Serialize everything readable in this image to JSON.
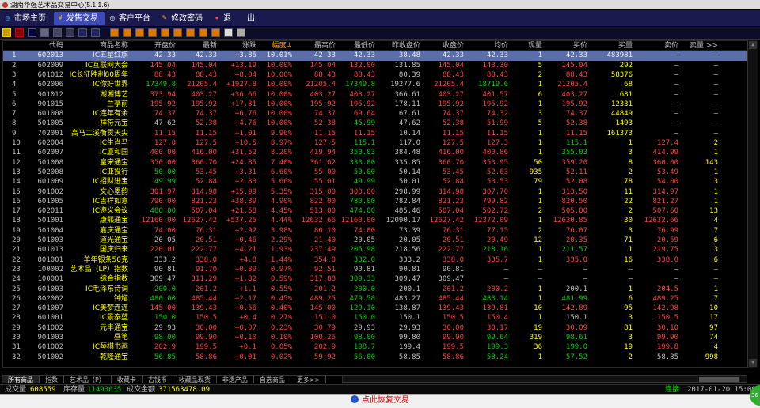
{
  "window": {
    "title": "湖南华强艺术品交易中心(5.1.1.6)"
  },
  "menu": [
    {
      "label": "市场主页",
      "icon": "globe-icon",
      "active": false
    },
    {
      "label": "发售交易",
      "icon": "money-icon",
      "active": true
    },
    {
      "label": "客户平台",
      "icon": "client-icon",
      "active": false
    },
    {
      "label": "修改密码",
      "icon": "key-icon",
      "active": false
    },
    {
      "label": "退　　出",
      "icon": "exit-icon",
      "active": false
    }
  ],
  "columns": [
    "",
    "代码",
    "商品名称",
    "开盘价",
    "最新",
    "涨跌",
    "幅度↓",
    "最高价",
    "最低价",
    "昨收盘价",
    "收盘价",
    "均价",
    "现量",
    "买价",
    "买量",
    "卖价",
    "卖量 >>"
  ],
  "rows": [
    [
      "1",
      "602013",
      "IC五星红旗",
      "42.33",
      "42.33",
      "+3.85",
      "10.01%",
      "42.33",
      "42.33",
      "38.48",
      "42.33",
      "42.33",
      "1",
      "42.33",
      "483981",
      "—",
      "—"
    ],
    [
      "2",
      "602009",
      "IC互联网大会",
      "145.04",
      "145.04",
      "+13.19",
      "10.00%",
      "145.04",
      "132.00",
      "131.85",
      "145.04",
      "143.30",
      "5",
      "145.04",
      "292",
      "—",
      "—"
    ],
    [
      "3",
      "601012",
      "IC长征胜利80周年",
      "88.43",
      "88.43",
      "+8.04",
      "10.00%",
      "88.43",
      "88.43",
      "80.39",
      "88.43",
      "88.43",
      "2",
      "88.43",
      "58376",
      "—",
      "—"
    ],
    [
      "4",
      "602006",
      "IC你好世界",
      "17349.8",
      "21205.4",
      "+1927.8",
      "10.00%",
      "21205.4",
      "17349.8",
      "19277.6",
      "21205.4",
      "18719.6",
      "1",
      "21205.4",
      "68",
      "—",
      "—"
    ],
    [
      "5",
      "901012",
      "湖湘博艺",
      "373.94",
      "403.27",
      "+36.66",
      "10.00%",
      "403.27",
      "403.27",
      "366.61",
      "403.27",
      "401.57",
      "6",
      "403.27",
      "681",
      "—",
      "—"
    ],
    [
      "6",
      "901015",
      "兰亭前",
      "195.92",
      "195.92",
      "+17.81",
      "10.00%",
      "195.92",
      "195.92",
      "178.11",
      "195.92",
      "195.92",
      "1",
      "195.92",
      "12331",
      "—",
      "—"
    ],
    [
      "7",
      "601008",
      "IC连年有余",
      "74.37",
      "74.37",
      "+6.76",
      "10.00%",
      "74.37",
      "69.64",
      "67.61",
      "74.37",
      "74.32",
      "3",
      "74.37",
      "44849",
      "—",
      "—"
    ],
    [
      "8",
      "501005",
      "祥符元宝",
      "47.62",
      "52.38",
      "+4.76",
      "10.00%",
      "52.38",
      "45.99",
      "47.62",
      "52.38",
      "51.99",
      "5",
      "52.38",
      "1493",
      "—",
      "—"
    ],
    [
      "9",
      "702001",
      "高马二溪衡贡天尖",
      "11.15",
      "11.15",
      "+1.01",
      "9.96%",
      "11.15",
      "11.15",
      "10.14",
      "11.15",
      "11.15",
      "1",
      "11.15",
      "161373",
      "—",
      "—"
    ],
    [
      "10",
      "602004",
      "IC生肖马",
      "127.0",
      "127.5",
      "+10.5",
      "8.97%",
      "127.5",
      "115.1",
      "117.0",
      "127.5",
      "127.3",
      "1",
      "115.1",
      "1",
      "127.4",
      "2"
    ],
    [
      "11",
      "602007",
      "IC厦和园",
      "400.00",
      "416.00",
      "+31.52",
      "8.20%",
      "419.94",
      "350.03",
      "384.48",
      "416.00",
      "400.86",
      "1",
      "355.03",
      "3",
      "414.99",
      "1"
    ],
    [
      "12",
      "501008",
      "皇宋通宝",
      "350.00",
      "360.70",
      "+24.85",
      "7.40%",
      "361.02",
      "333.00",
      "335.85",
      "360.70",
      "353.95",
      "50",
      "359.20",
      "8",
      "360.00",
      "143"
    ],
    [
      "13",
      "502008",
      "IC亚投行",
      "50.00",
      "53.45",
      "+3.31",
      "6.60%",
      "55.00",
      "50.00",
      "50.14",
      "53.45",
      "52.63",
      "935",
      "52.11",
      "2",
      "53.49",
      "1"
    ],
    [
      "14",
      "601009",
      "IC招财进宝",
      "49.99",
      "52.84",
      "+2.83",
      "5.66%",
      "55.01",
      "49.99",
      "50.01",
      "52.84",
      "53.53",
      "79",
      "52.08",
      "78",
      "54.00",
      "3"
    ],
    [
      "15",
      "901002",
      "文心墨韵",
      "301.97",
      "314.98",
      "+15.99",
      "5.35%",
      "315.00",
      "300.00",
      "298.99",
      "314.98",
      "307.70",
      "1",
      "313.50",
      "11",
      "314.97",
      "1"
    ],
    [
      "16",
      "601005",
      "IC吉祥如意",
      "790.00",
      "821.23",
      "+38.39",
      "4.90%",
      "822.00",
      "780.00",
      "782.84",
      "821.23",
      "799.82",
      "1",
      "820.50",
      "22",
      "821.27",
      "1"
    ],
    [
      "17",
      "602011",
      "IC遵义会议",
      "480.00",
      "507.04",
      "+21.58",
      "4.45%",
      "513.00",
      "474.00",
      "485.46",
      "507.04",
      "502.72",
      "2",
      "505.00",
      "2",
      "507.60",
      "13"
    ],
    [
      "18",
      "501001",
      "康熙通宝",
      "12160.00",
      "12627.42",
      "+537.25",
      "4.44%",
      "12632.66",
      "12160.00",
      "12090.17",
      "12627.42",
      "12372.09",
      "1",
      "12630.85",
      "30",
      "12632.66",
      "4"
    ],
    [
      "19",
      "501004",
      "嘉庆通宝",
      "74.00",
      "76.31",
      "+2.92",
      "3.98%",
      "80.10",
      "74.00",
      "73.39",
      "76.31",
      "77.15",
      "2",
      "76.07",
      "3",
      "76.99",
      "7"
    ],
    [
      "20",
      "501003",
      "道光通宝",
      "20.05",
      "20.51",
      "+0.46",
      "2.29%",
      "21.40",
      "20.05",
      "20.05",
      "20.51",
      "20.49",
      "12",
      "20.35",
      "71",
      "20.59",
      "6"
    ],
    [
      "21",
      "601013",
      "国庆归来",
      "220.01",
      "222.77",
      "+4.21",
      "1.93%",
      "237.49",
      "205.98",
      "218.56",
      "222.77",
      "218.16",
      "1",
      "211.57",
      "1",
      "219.75",
      "3"
    ],
    [
      "22",
      "801001",
      "羊年银条50克",
      "333.2",
      "338.0",
      "+4.8",
      "1.44%",
      "354.0",
      "332.0",
      "333.2",
      "338.0",
      "335.7",
      "1",
      "335.0",
      "16",
      "338.0",
      "6"
    ],
    [
      "23",
      "100002",
      "艺术品（LP）指数",
      "90.81",
      "91.70",
      "+0.89",
      "0.97%",
      "92.51",
      "90.81",
      "90.81",
      "90.81",
      "—",
      "—",
      "—",
      "—",
      "—",
      "—"
    ],
    [
      "24",
      "100001",
      "综合指数",
      "309.47",
      "311.29",
      "+1.82",
      "0.59%",
      "317.88",
      "309.33",
      "309.47",
      "309.47",
      "—",
      "—",
      "—",
      "—",
      "—",
      "—"
    ],
    [
      "25",
      "601003",
      "IC毛泽东诗词",
      "200.0",
      "201.2",
      "+1.1",
      "0.55%",
      "201.2",
      "200.0",
      "200.1",
      "201.2",
      "200.2",
      "1",
      "200.1",
      "1",
      "204.5",
      "1"
    ],
    [
      "26",
      "802002",
      "钟馗",
      "480.00",
      "485.44",
      "+2.17",
      "0.45%",
      "489.25",
      "479.58",
      "483.27",
      "485.44",
      "483.14",
      "1",
      "481.99",
      "6",
      "489.25",
      "7"
    ],
    [
      "27",
      "601007",
      "IC美梦连连",
      "145.00",
      "139.43",
      "+0.56",
      "0.40%",
      "145.00",
      "129.10",
      "138.87",
      "139.43",
      "139.81",
      "10",
      "142.89",
      "95",
      "142.98",
      "10"
    ],
    [
      "28",
      "601001",
      "IC景泰蓝",
      "150.0",
      "150.5",
      "+0.4",
      "0.27%",
      "151.0",
      "150.0",
      "150.1",
      "150.5",
      "150.4",
      "1",
      "150.1",
      "3",
      "150.5",
      "17"
    ],
    [
      "29",
      "501002",
      "元丰通宝",
      "29.93",
      "30.00",
      "+0.07",
      "0.23%",
      "30.79",
      "29.93",
      "29.93",
      "30.00",
      "30.17",
      "19",
      "30.09",
      "81",
      "30.10",
      "97"
    ],
    [
      "30",
      "901003",
      "昼笔",
      "98.00",
      "99.90",
      "+0.10",
      "0.10%",
      "100.26",
      "98.00",
      "99.80",
      "99.90",
      "99.64",
      "319",
      "98.61",
      "3",
      "99.90",
      "74"
    ],
    [
      "31",
      "601002",
      "IC琴棋书画",
      "202.9",
      "199.5",
      "+0.1",
      "0.05%",
      "202.9",
      "198.7",
      "199.4",
      "199.5",
      "199.3",
      "36",
      "199.0",
      "19",
      "199.8",
      "4"
    ],
    [
      "32",
      "501002",
      "乾隆通宝",
      "56.85",
      "58.86",
      "+0.01",
      "0.02%",
      "59.92",
      "56.00",
      "58.85",
      "58.86",
      "58.24",
      "1",
      "57.52",
      "2",
      "58.85",
      "998"
    ]
  ],
  "tabs": [
    "所有商品",
    "指数",
    "艺术品（P）",
    "收藏卡",
    "古钱币",
    "收藏品现货",
    "非遗产品",
    "自选商品",
    "更多>>"
  ],
  "status": {
    "vol_label": "成交量",
    "vol_value": "608559",
    "stock_label": "库存量",
    "stock_value": "11493635",
    "amount_label": "成交金额",
    "amount_value": "371563478.09",
    "conn": "连接",
    "datetime": "2017-01-20 15:00"
  },
  "footer": {
    "text": "点此恢复交易"
  },
  "badge": {
    "text": "36"
  },
  "colors": {
    "up": "#ff4040",
    "down": "#00d000",
    "flat": "#c0c0c0",
    "name": "#ffff00",
    "selected": "#5b6ea8",
    "menu_bg": "#1a1a4e",
    "menu_active": "#3c4bb8"
  }
}
